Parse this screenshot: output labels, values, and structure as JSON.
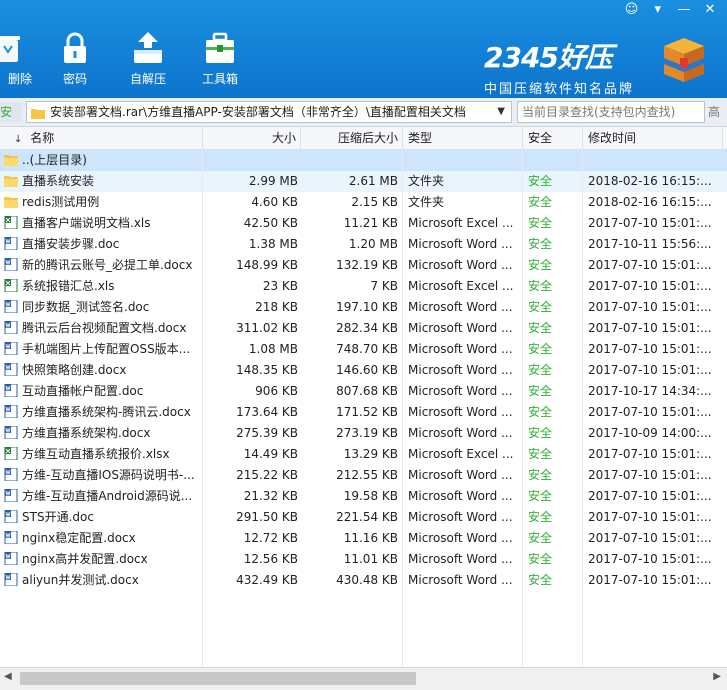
{
  "window_controls": [
    "☺",
    "▾",
    "—",
    "✕"
  ],
  "toolbar": {
    "items": [
      {
        "label": "删除",
        "icon": "delete-icon"
      },
      {
        "label": "密码",
        "icon": "lock-icon"
      },
      {
        "label": "自解压",
        "icon": "self-extract-icon"
      },
      {
        "label": "工具箱",
        "icon": "toolbox-icon"
      }
    ],
    "logo_title": "2345好压",
    "logo_subtitle": "中国压缩软件知名品牌"
  },
  "address": {
    "safe_tab": "安全",
    "path": "安装部署文档.rar\\方维直播APP-安装部署文档（非常齐全）\\直播配置相关文档",
    "search_placeholder": "当前目录查找(支持包内查找)",
    "right_clip": "高级"
  },
  "columns": {
    "name": "名称",
    "size": "大小",
    "compressed": "压缩后大小",
    "type": "类型",
    "safety": "安全",
    "modified": "修改时间"
  },
  "files": [
    {
      "name": "..(上层目录)",
      "kind": "folder",
      "size": "",
      "compressed": "",
      "type": "",
      "safety": "",
      "modified": ""
    },
    {
      "name": "直播系统安装",
      "kind": "folder",
      "size": "2.99 MB",
      "compressed": "2.61 MB",
      "type": "文件夹",
      "safety": "安全",
      "modified": "2018-02-16 16:15:..."
    },
    {
      "name": "redis测试用例",
      "kind": "folder",
      "size": "4.60 KB",
      "compressed": "2.15 KB",
      "type": "文件夹",
      "safety": "安全",
      "modified": "2018-02-16 16:15:..."
    },
    {
      "name": "直播客户端说明文档.xls",
      "kind": "excel",
      "size": "42.50 KB",
      "compressed": "11.21 KB",
      "type": "Microsoft Excel ...",
      "safety": "安全",
      "modified": "2017-07-10 15:01:..."
    },
    {
      "name": "直播安装步骤.doc",
      "kind": "word",
      "size": "1.38 MB",
      "compressed": "1.20 MB",
      "type": "Microsoft Word ...",
      "safety": "安全",
      "modified": "2017-10-11 15:56:..."
    },
    {
      "name": "新的腾讯云账号_必提工单.docx",
      "kind": "word",
      "size": "148.99 KB",
      "compressed": "132.19 KB",
      "type": "Microsoft Word ...",
      "safety": "安全",
      "modified": "2017-07-10 15:01:..."
    },
    {
      "name": "系统报错汇总.xls",
      "kind": "excel",
      "size": "23 KB",
      "compressed": "7 KB",
      "type": "Microsoft Excel ...",
      "safety": "安全",
      "modified": "2017-07-10 15:01:..."
    },
    {
      "name": "同步数据_测试签名.doc",
      "kind": "word",
      "size": "218 KB",
      "compressed": "197.10 KB",
      "type": "Microsoft Word ...",
      "safety": "安全",
      "modified": "2017-07-10 15:01:..."
    },
    {
      "name": "腾讯云后台视频配置文档.docx",
      "kind": "word",
      "size": "311.02 KB",
      "compressed": "282.34 KB",
      "type": "Microsoft Word ...",
      "safety": "安全",
      "modified": "2017-07-10 15:01:..."
    },
    {
      "name": "手机端图片上传配置OSS版本...",
      "kind": "word",
      "size": "1.08 MB",
      "compressed": "748.70 KB",
      "type": "Microsoft Word ...",
      "safety": "安全",
      "modified": "2017-07-10 15:01:..."
    },
    {
      "name": "快照策略创建.docx",
      "kind": "word",
      "size": "148.35 KB",
      "compressed": "146.60 KB",
      "type": "Microsoft Word ...",
      "safety": "安全",
      "modified": "2017-07-10 15:01:..."
    },
    {
      "name": "互动直播帐户配置.doc",
      "kind": "word",
      "size": "906 KB",
      "compressed": "807.68 KB",
      "type": "Microsoft Word ...",
      "safety": "安全",
      "modified": "2017-10-17 14:34:..."
    },
    {
      "name": "方维直播系统架构-腾讯云.docx",
      "kind": "word",
      "size": "173.64 KB",
      "compressed": "171.52 KB",
      "type": "Microsoft Word ...",
      "safety": "安全",
      "modified": "2017-07-10 15:01:..."
    },
    {
      "name": "方维直播系统架构.docx",
      "kind": "word",
      "size": "275.39 KB",
      "compressed": "273.19 KB",
      "type": "Microsoft Word ...",
      "safety": "安全",
      "modified": "2017-10-09 14:00:..."
    },
    {
      "name": "方维互动直播系统报价.xlsx",
      "kind": "excel",
      "size": "14.49 KB",
      "compressed": "13.29 KB",
      "type": "Microsoft Excel ...",
      "safety": "安全",
      "modified": "2017-07-10 15:01:..."
    },
    {
      "name": "方维-互动直播IOS源码说明书-...",
      "kind": "word",
      "size": "215.22 KB",
      "compressed": "212.55 KB",
      "type": "Microsoft Word ...",
      "safety": "安全",
      "modified": "2017-07-10 15:01:..."
    },
    {
      "name": "方维-互动直播Android源码说...",
      "kind": "word",
      "size": "21.32 KB",
      "compressed": "19.58 KB",
      "type": "Microsoft Word ...",
      "safety": "安全",
      "modified": "2017-07-10 15:01:..."
    },
    {
      "name": "STS开通.doc",
      "kind": "word",
      "size": "291.50 KB",
      "compressed": "221.54 KB",
      "type": "Microsoft Word ...",
      "safety": "安全",
      "modified": "2017-07-10 15:01:..."
    },
    {
      "name": "nginx稳定配置.docx",
      "kind": "word",
      "size": "12.72 KB",
      "compressed": "11.16 KB",
      "type": "Microsoft Word ...",
      "safety": "安全",
      "modified": "2017-07-10 15:01:..."
    },
    {
      "name": "nginx高并发配置.docx",
      "kind": "word",
      "size": "12.56 KB",
      "compressed": "11.01 KB",
      "type": "Microsoft Word ...",
      "safety": "安全",
      "modified": "2017-07-10 15:01:..."
    },
    {
      "name": "aliyun并发测试.docx",
      "kind": "word",
      "size": "432.49 KB",
      "compressed": "430.48 KB",
      "type": "Microsoft Word ...",
      "safety": "安全",
      "modified": "2017-07-10 15:01:..."
    }
  ],
  "colors": {
    "toolbar_top": "#1a8fe0",
    "toolbar_bottom": "#0d74cc",
    "safe_green": "#31b131",
    "selected_row": "#cde6fb",
    "folder_yellow": "#f5c648"
  }
}
